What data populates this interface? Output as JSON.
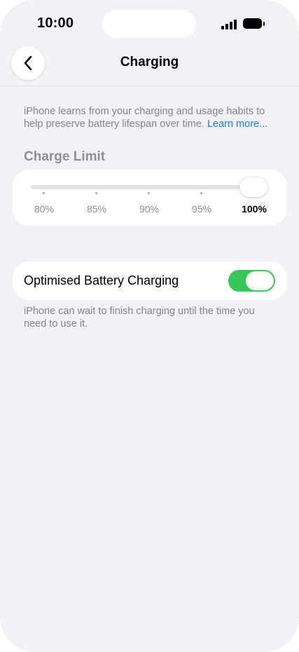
{
  "status_bar": {
    "time": "10:00",
    "signal_icon": "cellular-signal-icon",
    "battery_icon": "battery-full-icon"
  },
  "nav": {
    "title": "Charging",
    "back_icon": "chevron-left-icon"
  },
  "intro": {
    "text": "iPhone learns from your charging and usage habits to help preserve battery lifespan over time.",
    "link": "Learn more..."
  },
  "charge_limit": {
    "header": "Charge Limit",
    "ticks": [
      "80%",
      "85%",
      "90%",
      "95%",
      "100%"
    ],
    "selected": "100%"
  },
  "optimised": {
    "label": "Optimised Battery Charging",
    "enabled": true,
    "footnote": "iPhone can wait to finish charging until the time you need to use it."
  },
  "colors": {
    "background": "#f1f1f6",
    "switch_on": "#35c759",
    "link": "#1a7ae0",
    "secondary_text": "#83838a"
  }
}
